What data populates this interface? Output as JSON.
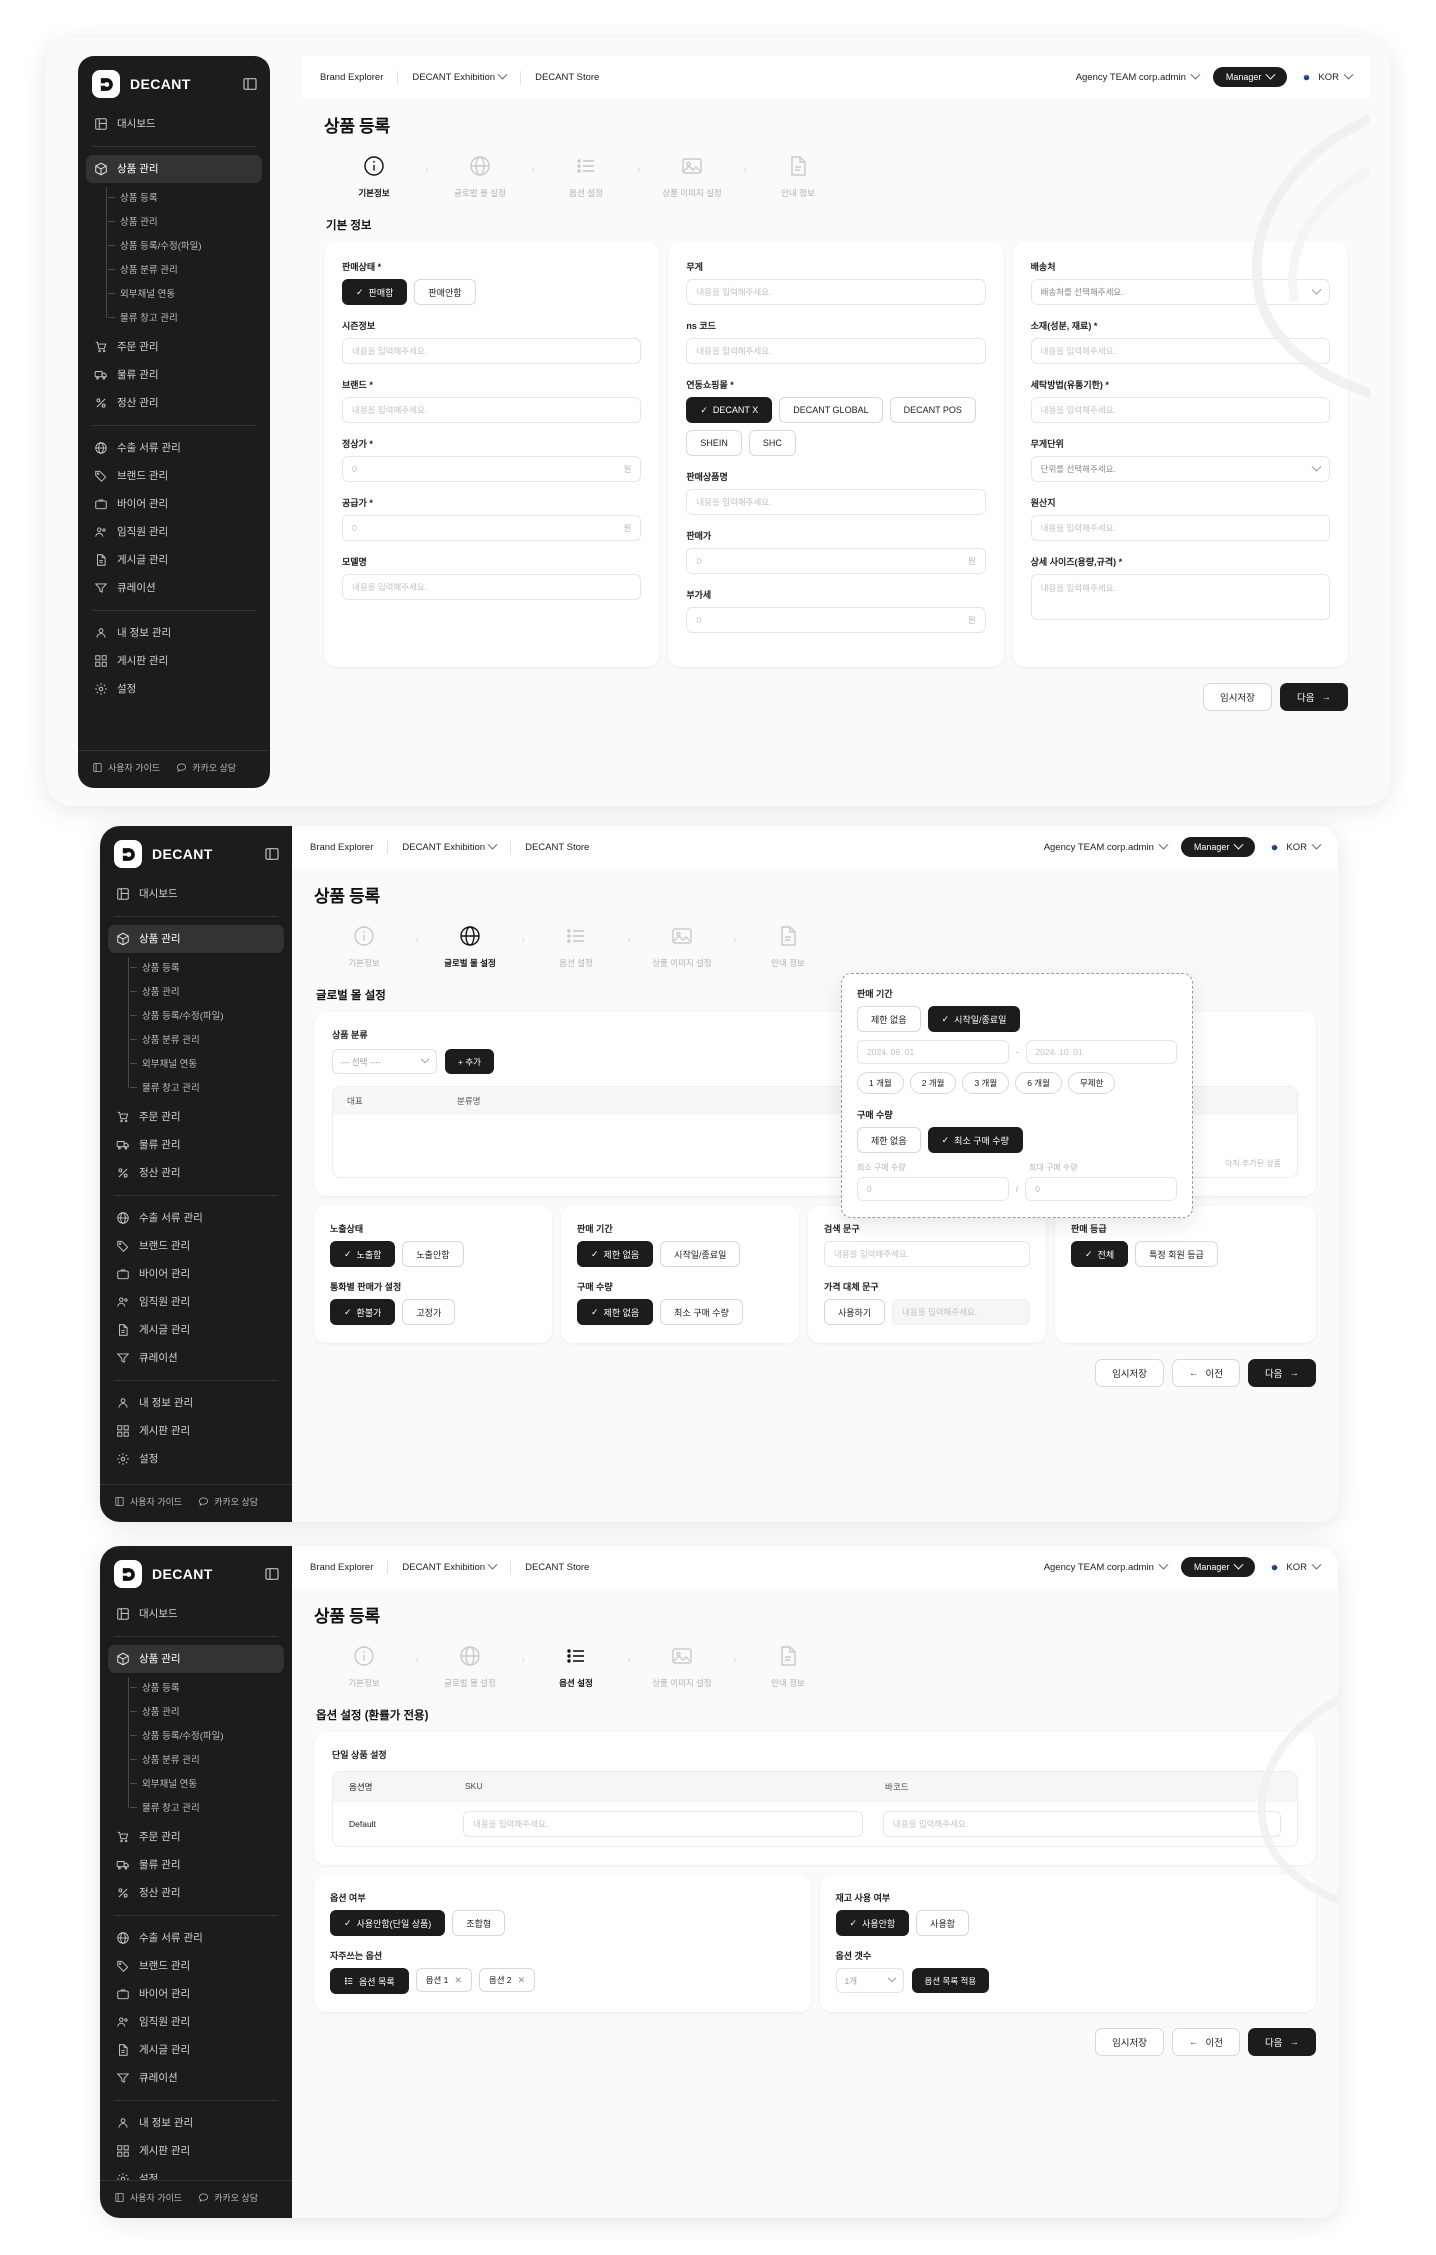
{
  "brand": {
    "name": "DECANT"
  },
  "sidebar": {
    "dashboard": "대시보드",
    "product_mgmt": "상품 관리",
    "product_sub": [
      "상품 등록",
      "상품 관리",
      "상품 등록/수정(파일)",
      "상품 분류 관리",
      "외부채널 연동",
      "물류 창고 관리"
    ],
    "group2": [
      "주문 관리",
      "물류 관리",
      "정산 관리"
    ],
    "group3": [
      "수출 서류 관리",
      "브랜드 관리",
      "바이어 관리",
      "임직원 관리",
      "게시글 관리",
      "큐레이션"
    ],
    "group4": [
      "내 정보 관리",
      "게시판 관리",
      "설정"
    ],
    "footer": {
      "guide": "사용자 가이드",
      "chat": "카카오 상담"
    }
  },
  "topbar": {
    "crumbs": [
      "Brand Explorer",
      "DECANT Exhibition",
      "DECANT Store"
    ],
    "account": "Agency TEAM corp.admin",
    "role": "Manager",
    "lang": "KOR"
  },
  "page": {
    "title": "상품 등록"
  },
  "stepper": [
    {
      "label": "기본정보",
      "icon": "info-icon"
    },
    {
      "label": "글로벌 몰 설정",
      "icon": "globe-icon"
    },
    {
      "label": "옵션 설정",
      "icon": "list-icon"
    },
    {
      "label": "상품 이미지 설정",
      "icon": "image-icon"
    },
    {
      "label": "안내 정보",
      "icon": "document-icon"
    }
  ],
  "placeholders": {
    "text": "내용을 입력해주세요.",
    "zero": "0",
    "select_ship": "배송처를 선택해주세요.",
    "select_unit": "단위를 선택해주세요."
  },
  "card1": {
    "section_title": "기본 정보",
    "col1": {
      "sale_state_label": "판매상태 *",
      "sale_state_on": "판매함",
      "sale_state_off": "판매안함",
      "season_label": "시즌정보",
      "brand_label": "브랜드 *",
      "normal_price_label": "정상가 *",
      "supply_price_label": "공급가 *",
      "model_label": "모델명",
      "currency": "원"
    },
    "col2": {
      "weight_label": "무게",
      "ns_label": "ns 코드",
      "mall_label": "연동쇼핑몰 *",
      "malls": [
        "DECANT X",
        "DECANT GLOBAL",
        "DECANT POS",
        "SHEIN",
        "SHC"
      ],
      "sale_name_label": "판매상품명",
      "sale_price_label": "판매가",
      "vat_label": "부가세",
      "currency": "원"
    },
    "col3": {
      "ship_label": "배송처",
      "material_label": "소재(성분, 재료) *",
      "wash_label": "세탁방법(유통기한) *",
      "weight_unit_label": "무게단위",
      "origin_label": "원산지",
      "size_label": "상세 사이즈(용량,규격) *"
    },
    "footer": {
      "temp_save": "임시저장",
      "next": "다음"
    }
  },
  "card2": {
    "section_title": "글로벌 몰 설정",
    "category_label": "상품 분류",
    "select_placeholder": "--- 선택 ----",
    "add_button": "+ 추가",
    "table_headers": [
      "대표",
      "분류명"
    ],
    "table_empty": "아직 추가된 상품",
    "popup": {
      "period_label": "판매 기간",
      "period_opts": [
        "제한 없음",
        "시작일/종료일"
      ],
      "period_selected": "시작일/종료일",
      "date_start": "2024. 09. 01",
      "date_end": "2024. 10. 01",
      "date_sep": "-",
      "chips": [
        "1 개월",
        "2 개월",
        "3 개월",
        "6 개월",
        "무제한"
      ],
      "qty_label": "구매 수량",
      "qty_opts": [
        "제한 없음",
        "최소 구매 수량"
      ],
      "qty_selected": "최소 구매 수량",
      "min_label": "최소 구매 수량",
      "max_label": "최대 구매 수량",
      "min_value": "0",
      "max_value": "0",
      "qty_sep": "/"
    },
    "mini1": {
      "expose_label": "노출상태",
      "expose_on": "노출함",
      "expose_off": "노출안함",
      "currency_label": "통화별 판매가 설정",
      "currency_on": "환불가",
      "currency_off": "고정가"
    },
    "mini2": {
      "period_label": "판매 기간",
      "period_on": "제한 없음",
      "period_off": "시작일/종료일",
      "qty_label": "구매 수량",
      "qty_on": "제한 없음",
      "qty_off": "최소 구매 수량"
    },
    "mini3": {
      "search_label": "검색 문구",
      "price_alt_label": "가격 대체 문구",
      "use_button": "사용하기"
    },
    "mini4": {
      "grade_label": "판매 등급",
      "grade_on": "전체",
      "grade_off": "특정 회원 등급"
    },
    "footer": {
      "temp_save": "임시저장",
      "prev": "이전",
      "next": "다음"
    }
  },
  "card3": {
    "section_title": "옵션 설정 (환률가 전용)",
    "single_label": "단일 상품 설정",
    "headers": [
      "옵션명",
      "SKU",
      "바코드"
    ],
    "row": {
      "name": "Default"
    },
    "left": {
      "opt_label": "옵션 여부",
      "opt_on": "사용안함(단일 상품)",
      "opt_off": "조합형",
      "fav_label": "자주쓰는 옵션",
      "fav_main": "옵션 목록",
      "fav_chips": [
        "옵션 1",
        "옵션 2"
      ]
    },
    "right": {
      "stock_label": "재고 사용 여부",
      "stock_on": "사용안함",
      "stock_off": "사용함",
      "count_label": "옵션 갯수",
      "count_value": "1개",
      "apply_button": "옵션 목록 적용"
    },
    "footer": {
      "temp_save": "임시저장",
      "prev": "이전",
      "next": "다음"
    }
  }
}
